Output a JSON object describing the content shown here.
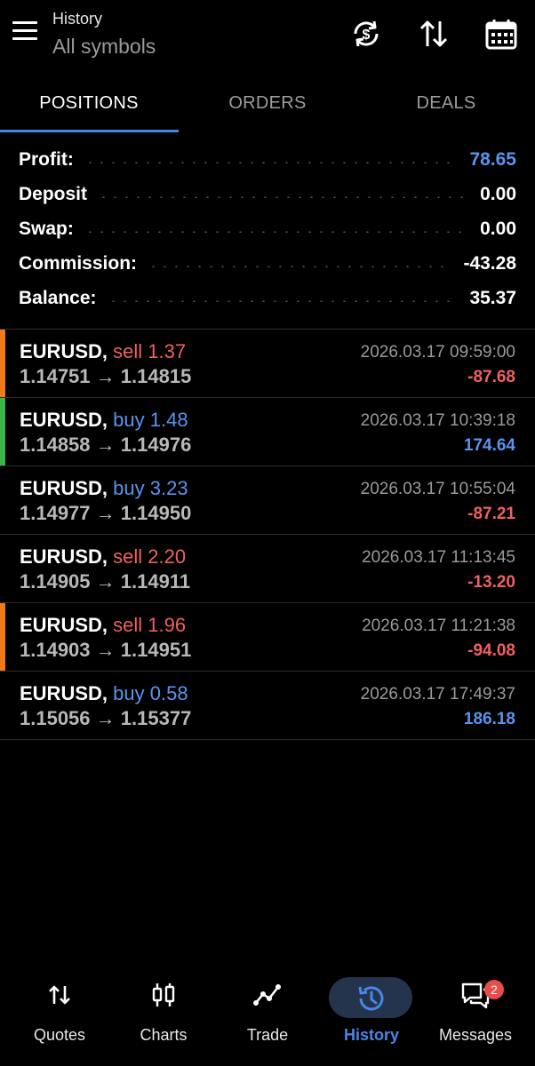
{
  "header": {
    "title": "History",
    "subtitle": "All symbols"
  },
  "tabs": [
    {
      "label": "POSITIONS",
      "active": true
    },
    {
      "label": "ORDERS",
      "active": false
    },
    {
      "label": "DEALS",
      "active": false
    }
  ],
  "summary": {
    "profit": {
      "label": "Profit:",
      "value": "78.65"
    },
    "deposit": {
      "label": "Deposit",
      "value": "0.00"
    },
    "swap": {
      "label": "Swap:",
      "value": "0.00"
    },
    "commission": {
      "label": "Commission:",
      "value": "-43.28"
    },
    "balance": {
      "label": "Balance:",
      "value": "35.37"
    }
  },
  "deals": [
    {
      "symbol": "EURUSD,",
      "side": "sell",
      "volume": "1.37",
      "open": "1.14751",
      "close": "1.14815",
      "time": "2026.03.17 09:59:00",
      "pl": "-87.68",
      "bar": "#f07a1a"
    },
    {
      "symbol": "EURUSD,",
      "side": "buy",
      "volume": "1.48",
      "open": "1.14858",
      "close": "1.14976",
      "time": "2026.03.17 10:39:18",
      "pl": "174.64",
      "bar": "#3bb54a"
    },
    {
      "symbol": "EURUSD,",
      "side": "buy",
      "volume": "3.23",
      "open": "1.14977",
      "close": "1.14950",
      "time": "2026.03.17 10:55:04",
      "pl": "-87.21",
      "bar": ""
    },
    {
      "symbol": "EURUSD,",
      "side": "sell",
      "volume": "2.20",
      "open": "1.14905",
      "close": "1.14911",
      "time": "2026.03.17 11:13:45",
      "pl": "-13.20",
      "bar": ""
    },
    {
      "symbol": "EURUSD,",
      "side": "sell",
      "volume": "1.96",
      "open": "1.14903",
      "close": "1.14951",
      "time": "2026.03.17 11:21:38",
      "pl": "-94.08",
      "bar": "#f07a1a"
    },
    {
      "symbol": "EURUSD,",
      "side": "buy",
      "volume": "0.58",
      "open": "1.15056",
      "close": "1.15377",
      "time": "2026.03.17 17:49:37",
      "pl": "186.18",
      "bar": ""
    }
  ],
  "arrow": "→",
  "nav": {
    "quotes": "Quotes",
    "charts": "Charts",
    "trade": "Trade",
    "history": "History",
    "messages": "Messages",
    "messages_badge": "2"
  },
  "colors": {
    "accent": "#4a86e8",
    "negative": "#f06060",
    "positive": "#5b93ef",
    "orange_bar": "#f07a1a",
    "green_bar": "#3bb54a"
  },
  "icons": [
    "menu-icon",
    "currency-refresh-icon",
    "sort-icon",
    "calendar-icon",
    "quotes-icon",
    "charts-icon",
    "trade-icon",
    "history-icon",
    "messages-icon"
  ]
}
